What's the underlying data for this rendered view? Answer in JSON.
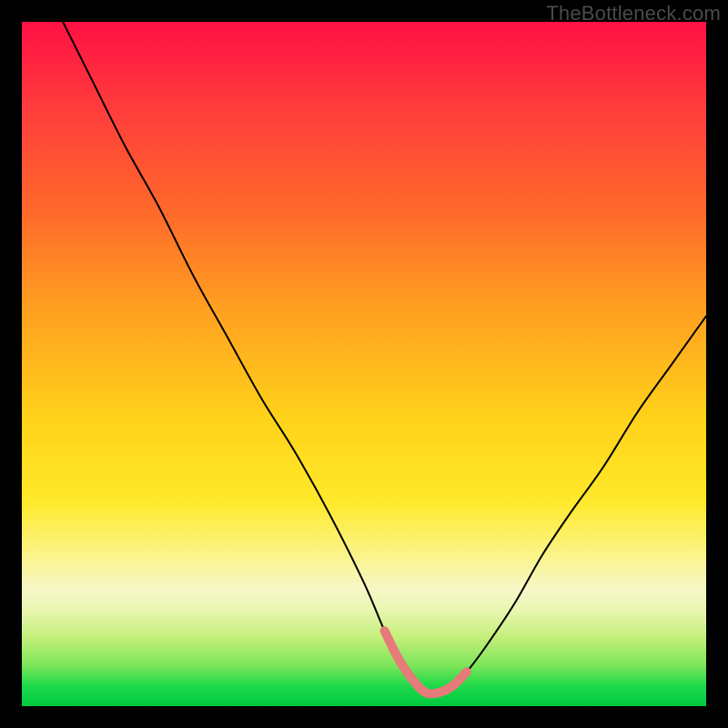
{
  "watermark": "TheBottleneck.com",
  "colors": {
    "background": "#000000",
    "curve": "#000000",
    "pink_marker": "#e77a7a",
    "gradient_top": "#ff1044",
    "gradient_bottom": "#00c940"
  },
  "chart_data": {
    "type": "line",
    "title": "",
    "xlabel": "",
    "ylabel": "",
    "xlim": [
      0,
      100
    ],
    "ylim": [
      0,
      100
    ],
    "grid": false,
    "annotations": [
      "TheBottleneck.com"
    ],
    "series": [
      {
        "name": "bottleneck-curve",
        "color": "#000000",
        "x": [
          6,
          10,
          15,
          20,
          25,
          30,
          35,
          40,
          45,
          50,
          53,
          55,
          57,
          59,
          61,
          63,
          65,
          68,
          72,
          76,
          80,
          85,
          90,
          95,
          100
        ],
        "y": [
          100,
          92,
          82,
          73,
          63,
          54,
          45,
          37,
          28,
          18,
          11,
          7,
          4,
          2,
          2,
          3,
          5,
          9,
          15,
          22,
          28,
          35,
          43,
          50,
          57
        ]
      },
      {
        "name": "optimal-range-marker",
        "color": "#e77a7a",
        "x": [
          53,
          55,
          57,
          59,
          61,
          63,
          65
        ],
        "y": [
          11,
          7,
          4,
          2,
          2,
          3,
          5
        ]
      }
    ],
    "notes": "V-shaped curve on a red-to-green vertical heat gradient; pink thick segment marks the valley floor (optimal pairing zone). No axis ticks or labels are rendered."
  }
}
